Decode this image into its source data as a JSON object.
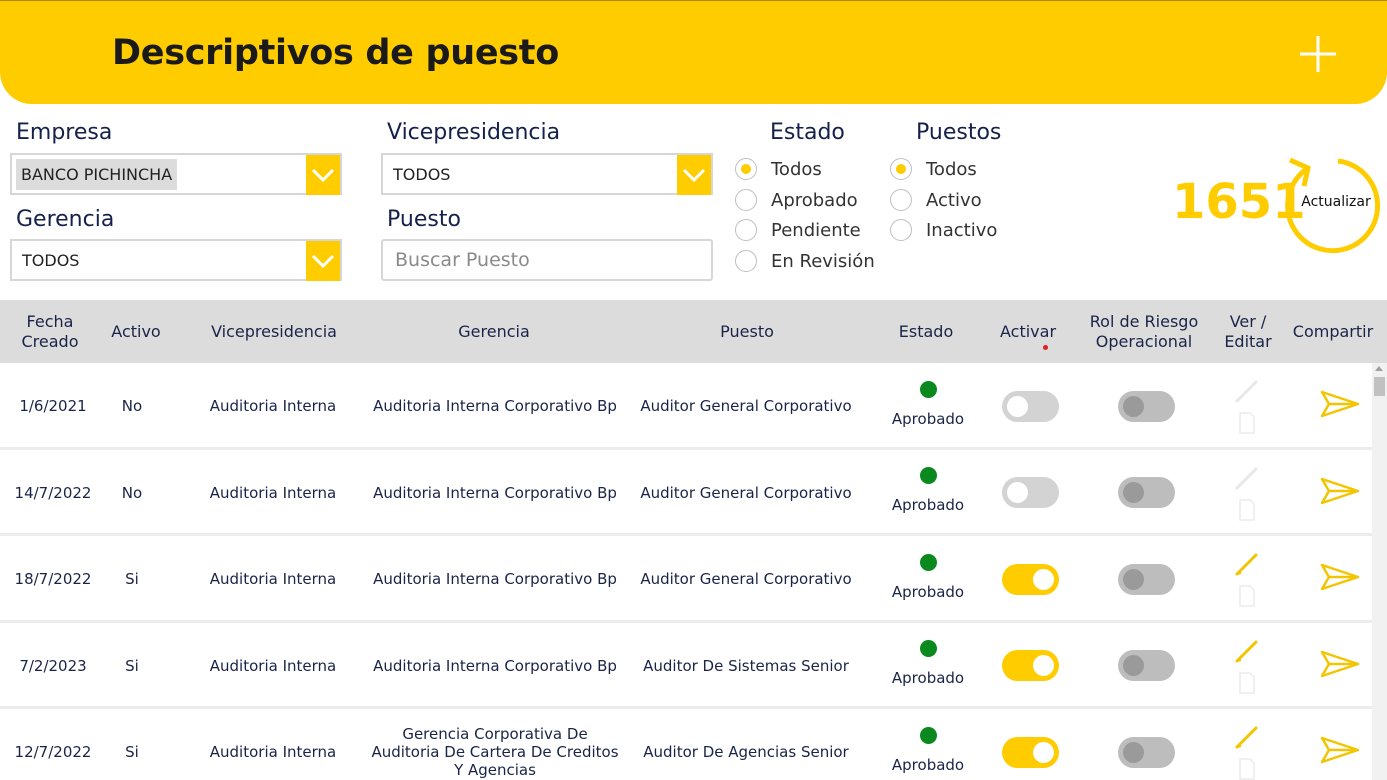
{
  "header": {
    "title": "Descriptivos de puesto",
    "add_icon": "plus-icon"
  },
  "filters": {
    "empresa": {
      "label": "Empresa",
      "value": "BANCO PICHINCHA"
    },
    "vicepresidencia": {
      "label": "Vicepresidencia",
      "value": "TODOS"
    },
    "gerencia": {
      "label": "Gerencia",
      "value": "TODOS"
    },
    "puesto": {
      "label": "Puesto",
      "placeholder": "Buscar Puesto"
    },
    "estado": {
      "label": "Estado",
      "options": [
        "Todos",
        "Aprobado",
        "Pendiente",
        "En Revisión"
      ],
      "selected": "Todos"
    },
    "puestos": {
      "label": "Puestos",
      "options": [
        "Todos",
        "Activo",
        "Inactivo"
      ],
      "selected": "Todos"
    }
  },
  "summary": {
    "count": "1651",
    "refresh_label": "Actualizar"
  },
  "table": {
    "columns": [
      "Fecha Creado",
      "Activo",
      "Vicepresidencia",
      "Gerencia",
      "Puesto",
      "Estado",
      "Activar",
      "Rol de Riesgo Operacional",
      "Ver / Editar",
      "Compartir"
    ],
    "rows": [
      {
        "fecha": "1/6/2021",
        "activo": "No",
        "vicepresidencia": "Auditoria Interna",
        "gerencia": "Auditoria Interna Corporativo Bp",
        "puesto": "Auditor General Corporativo",
        "estado": "Aprobado",
        "activar": false,
        "riesgo": false,
        "editable": false
      },
      {
        "fecha": "14/7/2022",
        "activo": "No",
        "vicepresidencia": "Auditoria Interna",
        "gerencia": "Auditoria Interna Corporativo Bp",
        "puesto": "Auditor General Corporativo",
        "estado": "Aprobado",
        "activar": false,
        "riesgo": false,
        "editable": false
      },
      {
        "fecha": "18/7/2022",
        "activo": "Si",
        "vicepresidencia": "Auditoria Interna",
        "gerencia": "Auditoria Interna Corporativo Bp",
        "puesto": "Auditor General Corporativo",
        "estado": "Aprobado",
        "activar": true,
        "riesgo": false,
        "editable": true
      },
      {
        "fecha": "7/2/2023",
        "activo": "Si",
        "vicepresidencia": "Auditoria Interna",
        "gerencia": "Auditoria Interna Corporativo Bp",
        "puesto": "Auditor De Sistemas Senior",
        "estado": "Aprobado",
        "activar": true,
        "riesgo": false,
        "editable": true
      },
      {
        "fecha": "12/7/2022",
        "activo": "Si",
        "vicepresidencia": "Auditoria Interna",
        "gerencia": "Gerencia Corporativa De Auditoria De Cartera De Creditos Y Agencias",
        "puesto": "Auditor De Agencias Senior",
        "estado": "Aprobado",
        "activar": true,
        "riesgo": false,
        "editable": true
      }
    ]
  },
  "colors": {
    "accent": "#ffcc00",
    "status_green": "#0a8a1e",
    "header_text": "#1a2448"
  }
}
